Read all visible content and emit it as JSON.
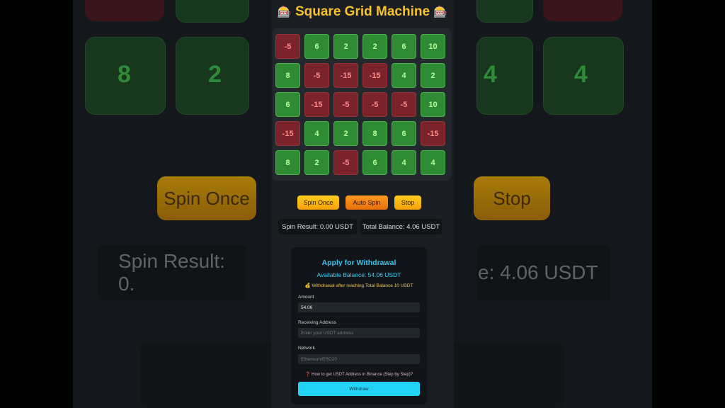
{
  "app": {
    "title": "Square Grid Machine",
    "title_icon": "slot-machine-icon"
  },
  "grid": {
    "rows": [
      [
        -5,
        6,
        2,
        2,
        6,
        10
      ],
      [
        8,
        -5,
        -15,
        -15,
        4,
        2
      ],
      [
        6,
        -15,
        -5,
        -5,
        -5,
        10
      ],
      [
        -15,
        4,
        2,
        8,
        6,
        -15
      ],
      [
        8,
        2,
        -5,
        6,
        4,
        4
      ]
    ]
  },
  "controls": {
    "spin_once": "Spin Once",
    "auto_spin": "Auto Spin",
    "stop": "Stop"
  },
  "status": {
    "spin_result": "Spin Result: 0.00 USDT",
    "total_balance": "Total Balance: 4.06 USDT"
  },
  "withdrawal": {
    "title": "Apply for Withdrawal",
    "available_balance": "Available Balance: 54.06 USDT",
    "note_icon": "money-bag-icon",
    "note": "Withdrawal after reaching Total Balance 10 USDT",
    "amount_label": "Amount",
    "amount_value": "54.06",
    "address_label": "Receiving Address",
    "address_placeholder": "Enter your USDT address",
    "network_label": "Network",
    "network_placeholder": "Ethereum/ERC20",
    "help_icon": "question-mark-icon",
    "help_text": "How to get USDT Address in Binance (Step by Step)?",
    "withdraw_button": "Withdraw"
  },
  "background": {
    "nums": [
      "8",
      "2",
      "4",
      "4"
    ],
    "spin_label": "Spin Once",
    "stop_label": "Stop",
    "spin_result": "Spin Result: 0.",
    "total_balance": "e: 4.06 USDT"
  },
  "colors": {
    "accent_gold": "#f6c12a",
    "positive_cell": "#2e8b34",
    "negative_cell": "#7a232b",
    "withdraw_accent": "#22d3f6"
  }
}
